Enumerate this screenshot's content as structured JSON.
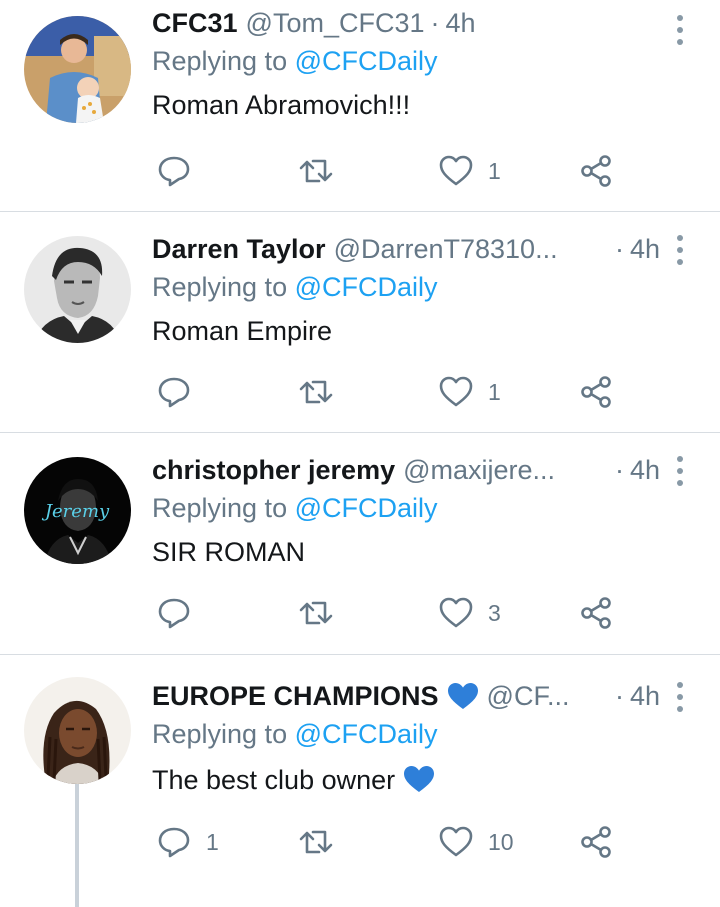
{
  "tweets": [
    {
      "name": "CFC31",
      "handle": "@Tom_CFC31",
      "separator": "·",
      "time": "4h",
      "replying_prefix": "Replying to",
      "replying_to": "@CFCDaily",
      "text": "Roman Abramovich!!!",
      "reply_count": "",
      "retweet_count": "",
      "like_count": "1"
    },
    {
      "name": "Darren Taylor",
      "handle": "@DarrenT78310...",
      "separator": "·",
      "time": "4h",
      "replying_prefix": "Replying to",
      "replying_to": "@CFCDaily",
      "text": "Roman Empire",
      "reply_count": "",
      "retweet_count": "",
      "like_count": "1"
    },
    {
      "name": "christopher jeremy",
      "handle": "@maxijere...",
      "separator": "·",
      "time": "4h",
      "replying_prefix": "Replying to",
      "replying_to": "@CFCDaily",
      "text": "SIR ROMAN",
      "reply_count": "",
      "retweet_count": "",
      "like_count": "3",
      "avatar_text": "Jeremy"
    },
    {
      "name": "EUROPE CHAMPIONS",
      "name_emoji": "blue-heart",
      "handle": "@CF...",
      "separator": "·",
      "time": "4h",
      "replying_prefix": "Replying to",
      "replying_to": "@CFCDaily",
      "text": "The best club owner",
      "text_emoji": "blue-heart",
      "reply_count": "1",
      "retweet_count": "",
      "like_count": "10"
    }
  ],
  "colors": {
    "accent": "#1da1f2",
    "secondary_text": "#657786",
    "heart_emoji": "#2e7fd9"
  },
  "icons": [
    "reply-icon",
    "retweet-icon",
    "like-icon",
    "share-icon",
    "more-options-icon",
    "blue-heart-emoji-icon"
  ]
}
